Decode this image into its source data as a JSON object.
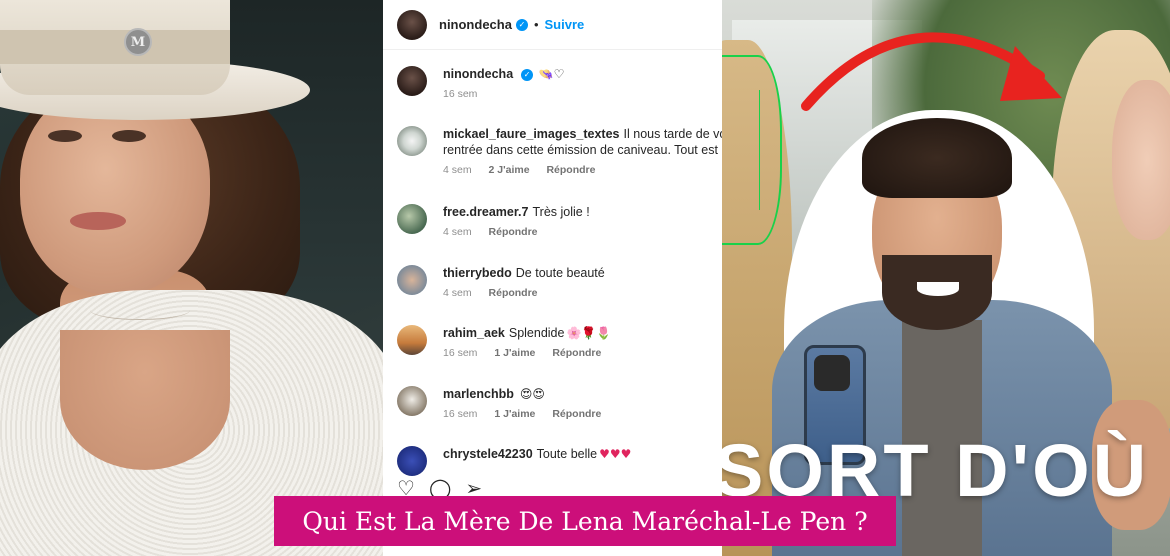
{
  "post": {
    "author": "ninondecha",
    "dot": "•",
    "follow_label": "Suivre",
    "caption_emojis": "👒♡",
    "caption_time": "16 sem"
  },
  "comments": [
    {
      "username": "mickael_faure_images_textes",
      "text_line1": "Il nous tarde de voi",
      "text_line2": "rentrée dans cette émission de caniveau. Tout est",
      "time": "4 sem",
      "likes": "2 J'aime",
      "reply": "Répondre"
    },
    {
      "username": "free.dreamer.7",
      "text_line1": "Très jolie !",
      "time": "4 sem",
      "reply": "Répondre"
    },
    {
      "username": "thierrybedo",
      "text_line1": "De toute beauté",
      "time": "4 sem",
      "reply": "Répondre"
    },
    {
      "username": "rahim_aek",
      "text_line1": "Splendide",
      "emojis": "🌸🌹🌷",
      "time": "16 sem",
      "likes": "1 J'aime",
      "reply": "Répondre"
    },
    {
      "username": "marlenchbb",
      "text_line1": "",
      "emojis": "😍😍",
      "time": "16 sem",
      "likes": "1 J'aime",
      "reply": "Répondre"
    },
    {
      "username": "chrystele42230",
      "text_line1": "Toute belle",
      "emojis": "♥♥♥"
    }
  ],
  "actions": {
    "like_icon": "♡",
    "comment_icon": "◯",
    "share_icon": "➢"
  },
  "thumbnail": {
    "overlay_text": "SORT D'OÙ",
    "hat_logo": "M"
  },
  "caption_banner": "Qui Est La Mère De Lena Maréchal-Le Pen ?",
  "colors": {
    "banner": "#cc0f7a",
    "instagram_blue": "#0095f6",
    "arrow_red": "#e8231f",
    "face_mesh_green": "#19d14a"
  }
}
